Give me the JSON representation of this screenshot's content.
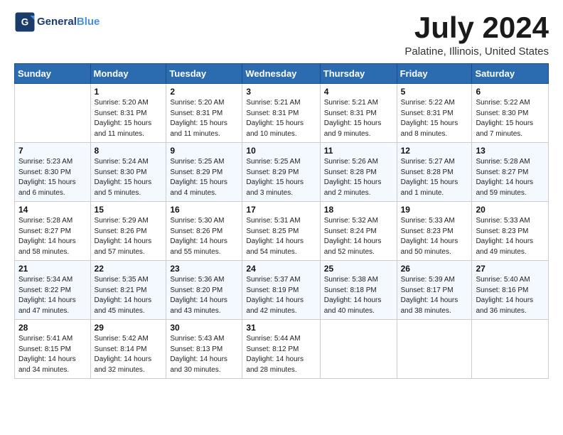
{
  "header": {
    "logo_text_general": "General",
    "logo_text_blue": "Blue",
    "month": "July 2024",
    "location": "Palatine, Illinois, United States"
  },
  "days_of_week": [
    "Sunday",
    "Monday",
    "Tuesday",
    "Wednesday",
    "Thursday",
    "Friday",
    "Saturday"
  ],
  "weeks": [
    [
      {
        "day": "",
        "info": ""
      },
      {
        "day": "1",
        "info": "Sunrise: 5:20 AM\nSunset: 8:31 PM\nDaylight: 15 hours\nand 11 minutes."
      },
      {
        "day": "2",
        "info": "Sunrise: 5:20 AM\nSunset: 8:31 PM\nDaylight: 15 hours\nand 11 minutes."
      },
      {
        "day": "3",
        "info": "Sunrise: 5:21 AM\nSunset: 8:31 PM\nDaylight: 15 hours\nand 10 minutes."
      },
      {
        "day": "4",
        "info": "Sunrise: 5:21 AM\nSunset: 8:31 PM\nDaylight: 15 hours\nand 9 minutes."
      },
      {
        "day": "5",
        "info": "Sunrise: 5:22 AM\nSunset: 8:31 PM\nDaylight: 15 hours\nand 8 minutes."
      },
      {
        "day": "6",
        "info": "Sunrise: 5:22 AM\nSunset: 8:30 PM\nDaylight: 15 hours\nand 7 minutes."
      }
    ],
    [
      {
        "day": "7",
        "info": "Sunrise: 5:23 AM\nSunset: 8:30 PM\nDaylight: 15 hours\nand 6 minutes."
      },
      {
        "day": "8",
        "info": "Sunrise: 5:24 AM\nSunset: 8:30 PM\nDaylight: 15 hours\nand 5 minutes."
      },
      {
        "day": "9",
        "info": "Sunrise: 5:25 AM\nSunset: 8:29 PM\nDaylight: 15 hours\nand 4 minutes."
      },
      {
        "day": "10",
        "info": "Sunrise: 5:25 AM\nSunset: 8:29 PM\nDaylight: 15 hours\nand 3 minutes."
      },
      {
        "day": "11",
        "info": "Sunrise: 5:26 AM\nSunset: 8:28 PM\nDaylight: 15 hours\nand 2 minutes."
      },
      {
        "day": "12",
        "info": "Sunrise: 5:27 AM\nSunset: 8:28 PM\nDaylight: 15 hours\nand 1 minute."
      },
      {
        "day": "13",
        "info": "Sunrise: 5:28 AM\nSunset: 8:27 PM\nDaylight: 14 hours\nand 59 minutes."
      }
    ],
    [
      {
        "day": "14",
        "info": "Sunrise: 5:28 AM\nSunset: 8:27 PM\nDaylight: 14 hours\nand 58 minutes."
      },
      {
        "day": "15",
        "info": "Sunrise: 5:29 AM\nSunset: 8:26 PM\nDaylight: 14 hours\nand 57 minutes."
      },
      {
        "day": "16",
        "info": "Sunrise: 5:30 AM\nSunset: 8:26 PM\nDaylight: 14 hours\nand 55 minutes."
      },
      {
        "day": "17",
        "info": "Sunrise: 5:31 AM\nSunset: 8:25 PM\nDaylight: 14 hours\nand 54 minutes."
      },
      {
        "day": "18",
        "info": "Sunrise: 5:32 AM\nSunset: 8:24 PM\nDaylight: 14 hours\nand 52 minutes."
      },
      {
        "day": "19",
        "info": "Sunrise: 5:33 AM\nSunset: 8:23 PM\nDaylight: 14 hours\nand 50 minutes."
      },
      {
        "day": "20",
        "info": "Sunrise: 5:33 AM\nSunset: 8:23 PM\nDaylight: 14 hours\nand 49 minutes."
      }
    ],
    [
      {
        "day": "21",
        "info": "Sunrise: 5:34 AM\nSunset: 8:22 PM\nDaylight: 14 hours\nand 47 minutes."
      },
      {
        "day": "22",
        "info": "Sunrise: 5:35 AM\nSunset: 8:21 PM\nDaylight: 14 hours\nand 45 minutes."
      },
      {
        "day": "23",
        "info": "Sunrise: 5:36 AM\nSunset: 8:20 PM\nDaylight: 14 hours\nand 43 minutes."
      },
      {
        "day": "24",
        "info": "Sunrise: 5:37 AM\nSunset: 8:19 PM\nDaylight: 14 hours\nand 42 minutes."
      },
      {
        "day": "25",
        "info": "Sunrise: 5:38 AM\nSunset: 8:18 PM\nDaylight: 14 hours\nand 40 minutes."
      },
      {
        "day": "26",
        "info": "Sunrise: 5:39 AM\nSunset: 8:17 PM\nDaylight: 14 hours\nand 38 minutes."
      },
      {
        "day": "27",
        "info": "Sunrise: 5:40 AM\nSunset: 8:16 PM\nDaylight: 14 hours\nand 36 minutes."
      }
    ],
    [
      {
        "day": "28",
        "info": "Sunrise: 5:41 AM\nSunset: 8:15 PM\nDaylight: 14 hours\nand 34 minutes."
      },
      {
        "day": "29",
        "info": "Sunrise: 5:42 AM\nSunset: 8:14 PM\nDaylight: 14 hours\nand 32 minutes."
      },
      {
        "day": "30",
        "info": "Sunrise: 5:43 AM\nSunset: 8:13 PM\nDaylight: 14 hours\nand 30 minutes."
      },
      {
        "day": "31",
        "info": "Sunrise: 5:44 AM\nSunset: 8:12 PM\nDaylight: 14 hours\nand 28 minutes."
      },
      {
        "day": "",
        "info": ""
      },
      {
        "day": "",
        "info": ""
      },
      {
        "day": "",
        "info": ""
      }
    ]
  ]
}
